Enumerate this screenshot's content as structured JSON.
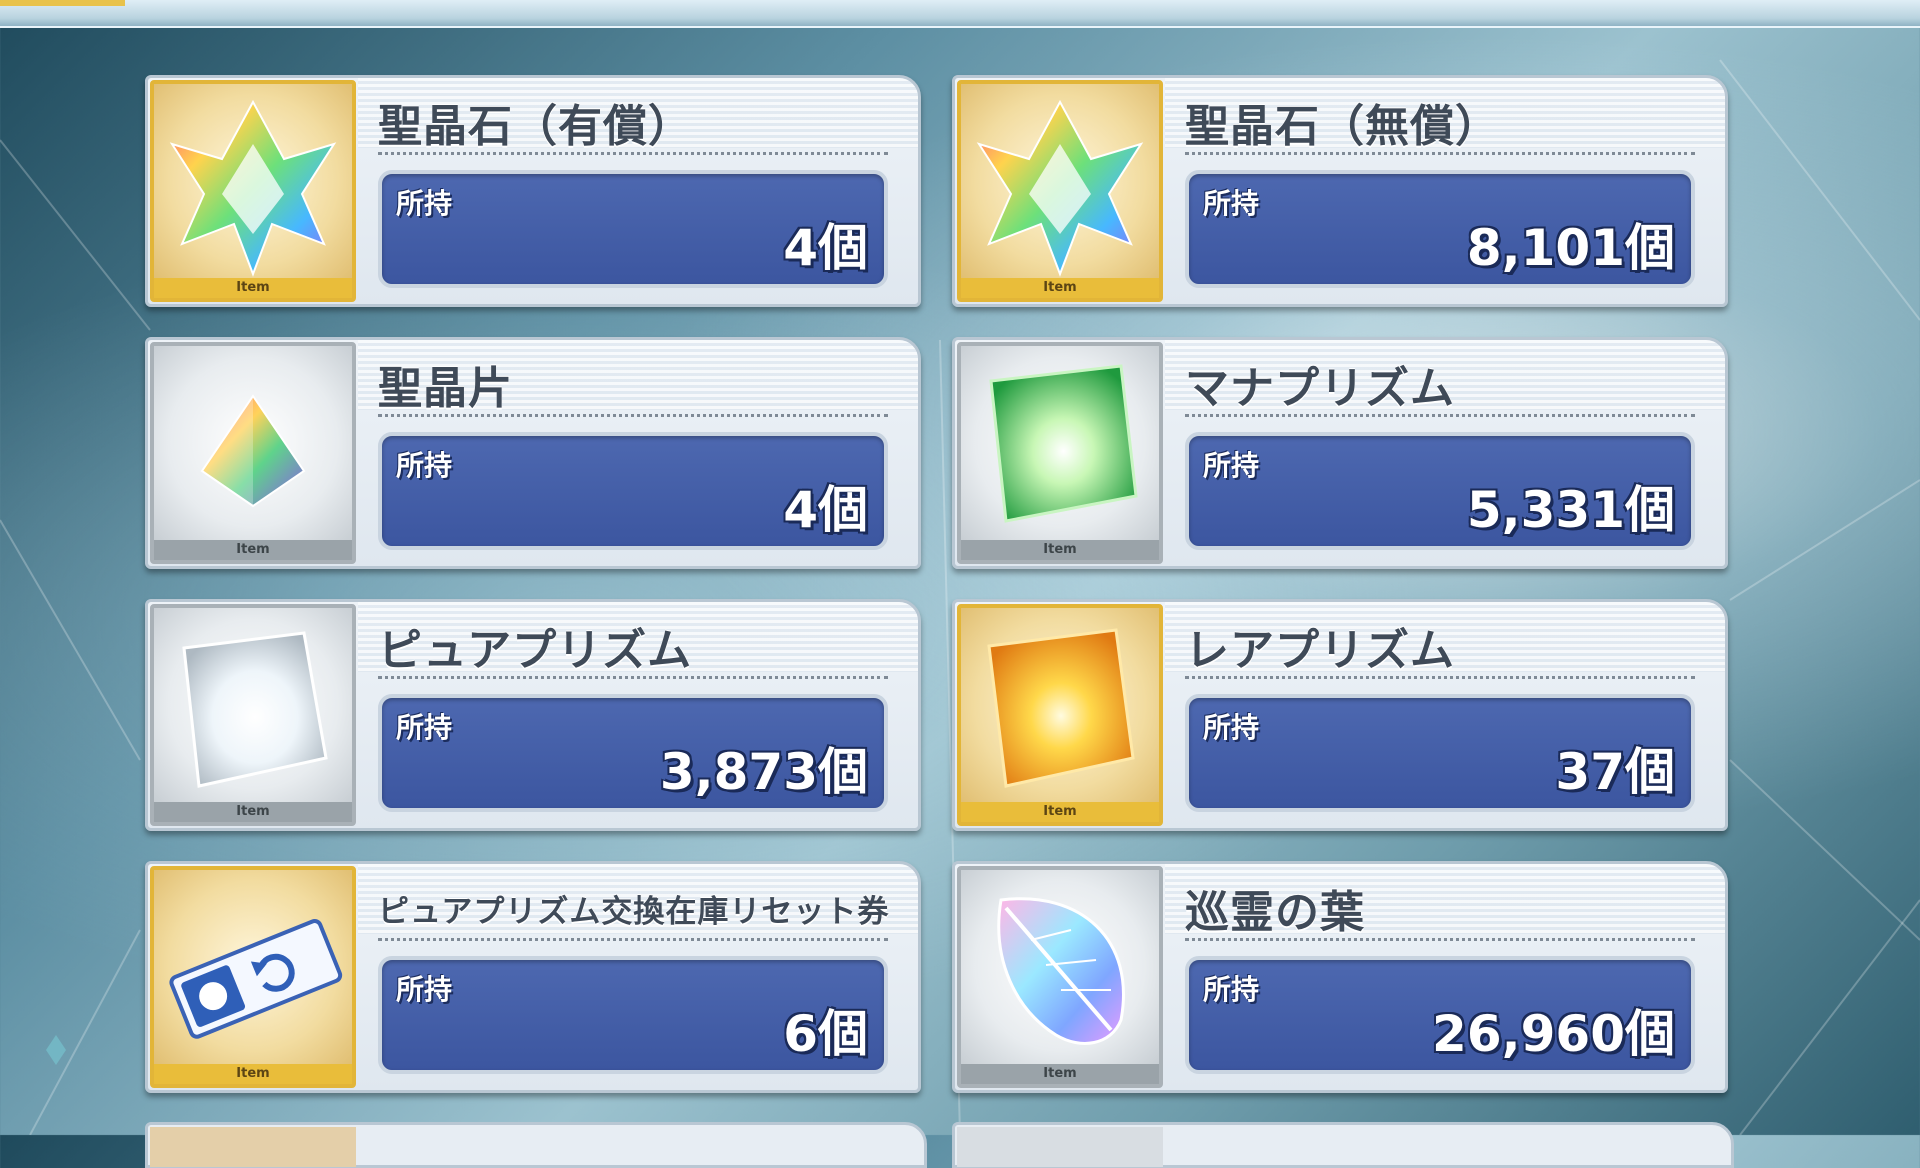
{
  "owned_label": "所持",
  "icon_tag": "Item",
  "items": [
    {
      "name": "聖晶石（有償）",
      "count": "4個",
      "icon": "saint-quartz-icon",
      "frame": "gold"
    },
    {
      "name": "聖晶石（無償）",
      "count": "8,101個",
      "icon": "saint-quartz-icon",
      "frame": "gold"
    },
    {
      "name": "聖晶片",
      "count": "4個",
      "icon": "saint-quartz-fragment-icon",
      "frame": "silver"
    },
    {
      "name": "マナプリズム",
      "count": "5,331個",
      "icon": "mana-prism-icon",
      "frame": "silver"
    },
    {
      "name": "ピュアプリズム",
      "count": "3,873個",
      "icon": "pure-prism-icon",
      "frame": "silver"
    },
    {
      "name": "レアプリズム",
      "count": "37個",
      "icon": "rare-prism-icon",
      "frame": "gold"
    },
    {
      "name": "ピュアプリズム交換在庫リセット券",
      "count": "6個",
      "icon": "reset-ticket-icon",
      "frame": "gold"
    },
    {
      "name": "巡霊の葉",
      "count": "26,960個",
      "icon": "leaf-icon",
      "frame": "silver"
    }
  ],
  "colors": {
    "panel_blue": "#3c56a0",
    "gold_frame": "#e2b538",
    "silver_frame": "#a9b1b7"
  }
}
